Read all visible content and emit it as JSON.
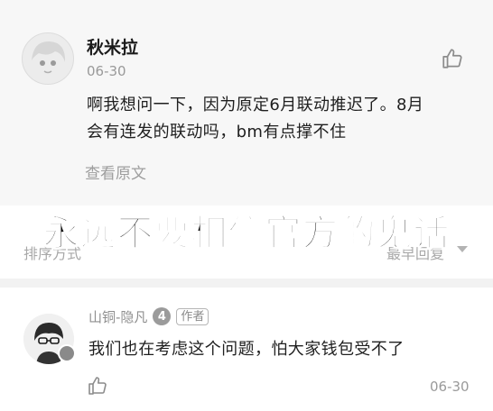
{
  "comment1": {
    "username": "秋米拉",
    "date": "06-30",
    "content_lines": [
      "啊我想问一下，因为原定6月联动推迟了。8月",
      "会有连发的联动吗，bm有点撑不住"
    ],
    "view_original": "查看原文"
  },
  "sort": {
    "left_label": "排序方式",
    "right_label": "最早回复"
  },
  "overlay_caption": "永远不要相信官方的鬼话",
  "comment2": {
    "username": "山铜-隐凡",
    "level": "4",
    "author_tag": "作者",
    "content": "我们也在考虑这个问题，怕大家钱包受不了",
    "date": "06-30"
  },
  "icons": {
    "like": "thumbs-up-icon",
    "dropdown": "caret-down-icon"
  }
}
